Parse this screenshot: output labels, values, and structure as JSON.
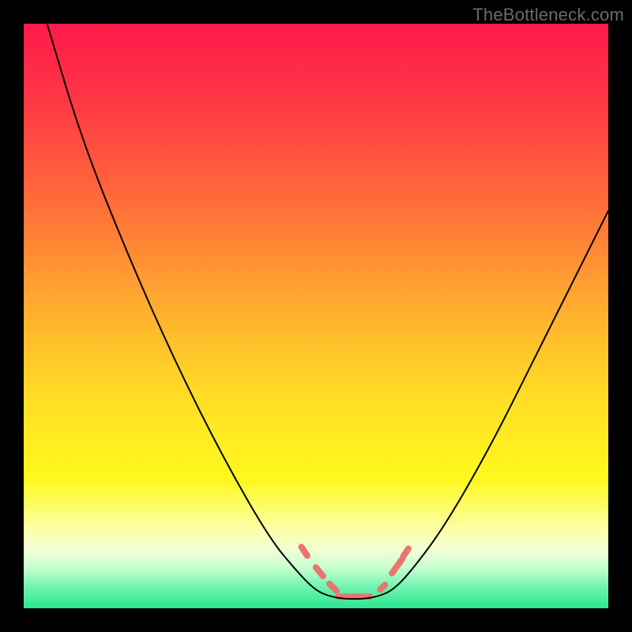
{
  "watermark": "TheBottleneck.com",
  "chart_data": {
    "type": "line",
    "title": "",
    "xlabel": "",
    "ylabel": "",
    "xlim": [
      0,
      100
    ],
    "ylim": [
      0,
      100
    ],
    "background_gradient": [
      {
        "stop": 0.0,
        "color": "#ff1a4a"
      },
      {
        "stop": 0.12,
        "color": "#ff3445"
      },
      {
        "stop": 0.3,
        "color": "#ff6a3a"
      },
      {
        "stop": 0.5,
        "color": "#ffb22e"
      },
      {
        "stop": 0.65,
        "color": "#ffe024"
      },
      {
        "stop": 0.78,
        "color": "#fff81e"
      },
      {
        "stop": 0.86,
        "color": "#fcffa0"
      },
      {
        "stop": 0.9,
        "color": "#f2ffd6"
      },
      {
        "stop": 0.93,
        "color": "#c8ffcf"
      },
      {
        "stop": 0.96,
        "color": "#78f5b3"
      },
      {
        "stop": 1.0,
        "color": "#2ae68e"
      }
    ],
    "series": [
      {
        "name": "bottleneck-curve",
        "color": "#000000",
        "stroke_width": 2,
        "points": [
          {
            "x": 4,
            "y": 100
          },
          {
            "x": 10,
            "y": 80
          },
          {
            "x": 18,
            "y": 60
          },
          {
            "x": 26,
            "y": 42
          },
          {
            "x": 34,
            "y": 26
          },
          {
            "x": 42,
            "y": 12
          },
          {
            "x": 47,
            "y": 6
          },
          {
            "x": 50,
            "y": 3
          },
          {
            "x": 52.5,
            "y": 2
          },
          {
            "x": 55,
            "y": 1.6
          },
          {
            "x": 58,
            "y": 1.6
          },
          {
            "x": 60.5,
            "y": 2
          },
          {
            "x": 63,
            "y": 3
          },
          {
            "x": 66,
            "y": 6
          },
          {
            "x": 72,
            "y": 14
          },
          {
            "x": 80,
            "y": 28
          },
          {
            "x": 88,
            "y": 44
          },
          {
            "x": 96,
            "y": 60
          },
          {
            "x": 100,
            "y": 68
          }
        ]
      }
    ],
    "highlight_segments": {
      "color": "#e8766f",
      "stroke_width": 8,
      "segments": [
        {
          "from": {
            "x": 47.5,
            "y": 10.5
          },
          "to": {
            "x": 48.5,
            "y": 9.0
          }
        },
        {
          "from": {
            "x": 50.0,
            "y": 7.0
          },
          "to": {
            "x": 51.2,
            "y": 5.5
          }
        },
        {
          "from": {
            "x": 52.3,
            "y": 4.2
          },
          "to": {
            "x": 53.5,
            "y": 3.0
          }
        },
        {
          "from": {
            "x": 53.8,
            "y": 2.0
          },
          "to": {
            "x": 59.2,
            "y": 2.0
          }
        },
        {
          "from": {
            "x": 61.0,
            "y": 3.2
          },
          "to": {
            "x": 61.8,
            "y": 4.0
          }
        },
        {
          "from": {
            "x": 63.0,
            "y": 6.0
          },
          "to": {
            "x": 64.8,
            "y": 8.5
          }
        },
        {
          "from": {
            "x": 65.0,
            "y": 9.0
          },
          "to": {
            "x": 65.8,
            "y": 10.2
          }
        }
      ]
    }
  }
}
